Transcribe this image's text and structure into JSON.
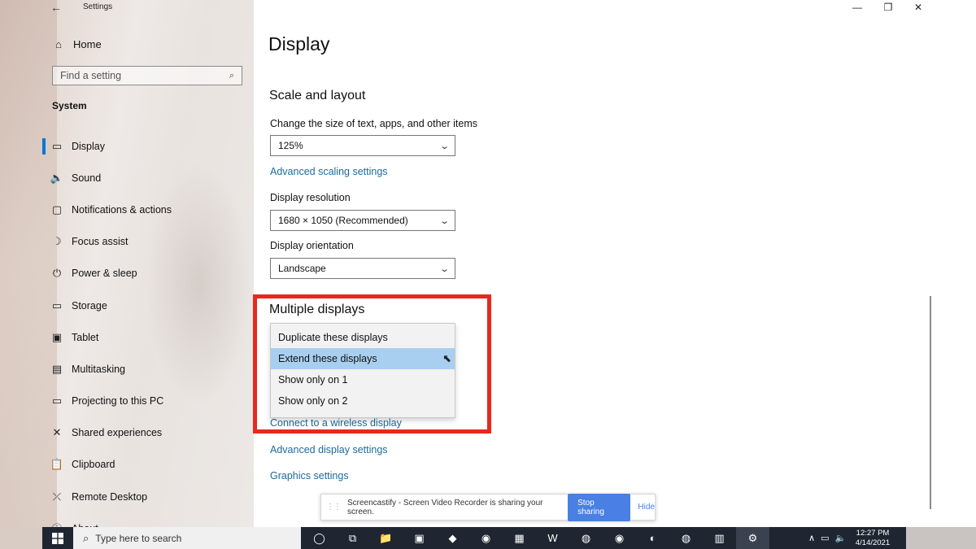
{
  "window": {
    "title": "Settings",
    "controls": {
      "minimize": "—",
      "maximize": "❐",
      "close": "✕"
    }
  },
  "sidebar": {
    "home_label": "Home",
    "search_placeholder": "Find a setting",
    "section": "System",
    "items": [
      {
        "label": "Display",
        "icon": "monitor-icon",
        "glyph": "▭",
        "active": true
      },
      {
        "label": "Sound",
        "icon": "speaker-icon",
        "glyph": "🔈"
      },
      {
        "label": "Notifications & actions",
        "icon": "notification-icon",
        "glyph": "▢"
      },
      {
        "label": "Focus assist",
        "icon": "moon-icon",
        "glyph": "☽"
      },
      {
        "label": "Power & sleep",
        "icon": "power-icon",
        "glyph": "⏻"
      },
      {
        "label": "Storage",
        "icon": "storage-icon",
        "glyph": "▭"
      },
      {
        "label": "Tablet",
        "icon": "tablet-icon",
        "glyph": "▣"
      },
      {
        "label": "Multitasking",
        "icon": "multitasking-icon",
        "glyph": "▤"
      },
      {
        "label": "Projecting to this PC",
        "icon": "projecting-icon",
        "glyph": "▭"
      },
      {
        "label": "Shared experiences",
        "icon": "shared-icon",
        "glyph": "✕"
      },
      {
        "label": "Clipboard",
        "icon": "clipboard-icon",
        "glyph": "📋"
      },
      {
        "label": "Remote Desktop",
        "icon": "remote-desktop-icon",
        "glyph": "⤫"
      },
      {
        "label": "About",
        "icon": "info-icon",
        "glyph": "ⓘ"
      }
    ]
  },
  "main": {
    "title": "Display",
    "scale_section": "Scale and layout",
    "scale_label": "Change the size of text, apps, and other items",
    "scale_value": "125%",
    "advanced_scaling": "Advanced scaling settings",
    "resolution_label": "Display resolution",
    "resolution_value": "1680 × 1050 (Recommended)",
    "orientation_label": "Display orientation",
    "orientation_value": "Landscape",
    "multiple_section": "Multiple displays",
    "multiple_options": [
      {
        "label": "Duplicate these displays"
      },
      {
        "label": "Extend these displays",
        "selected": true
      },
      {
        "label": "Show only on 1"
      },
      {
        "label": "Show only on 2"
      }
    ],
    "connect_wireless": "Connect to a wireless display",
    "advanced_display": "Advanced display settings",
    "graphics_settings": "Graphics settings"
  },
  "sharebar": {
    "message": "Screencastify - Screen Video Recorder is sharing your screen.",
    "stop_label": "Stop sharing",
    "hide_label": "Hide"
  },
  "taskbar": {
    "search_placeholder": "Type here to search",
    "time": "12:27 PM",
    "date": "4/14/2021",
    "apps": [
      {
        "name": "task-view-icon",
        "glyph": "◯"
      },
      {
        "name": "timeline-icon",
        "glyph": "⧉"
      },
      {
        "name": "file-explorer-icon",
        "glyph": "📁"
      },
      {
        "name": "video-app-icon",
        "glyph": "▣"
      },
      {
        "name": "browser-app-icon",
        "glyph": "◆"
      },
      {
        "name": "android-app-icon",
        "glyph": "◉"
      },
      {
        "name": "calculator-icon",
        "glyph": "▦"
      },
      {
        "name": "word-icon",
        "glyph": "W"
      },
      {
        "name": "chrome-icon",
        "glyph": "◍"
      },
      {
        "name": "zoom-icon",
        "glyph": "◉"
      },
      {
        "name": "edge-icon",
        "glyph": "◐"
      },
      {
        "name": "chrome-profile-icon",
        "glyph": "◍"
      },
      {
        "name": "outlook-icon",
        "glyph": "▥"
      },
      {
        "name": "settings-gear-icon",
        "glyph": "⚙",
        "active": true
      }
    ],
    "tray_glyphs": [
      "∧",
      "▭",
      "🔈"
    ]
  },
  "colors": {
    "accent": "#0078d7",
    "link": "#1c6b9b",
    "highlight_border": "#e8281e",
    "selected_option": "#a9cff0",
    "stop_button": "#4a7fe4",
    "taskbar": "#1f2631"
  }
}
